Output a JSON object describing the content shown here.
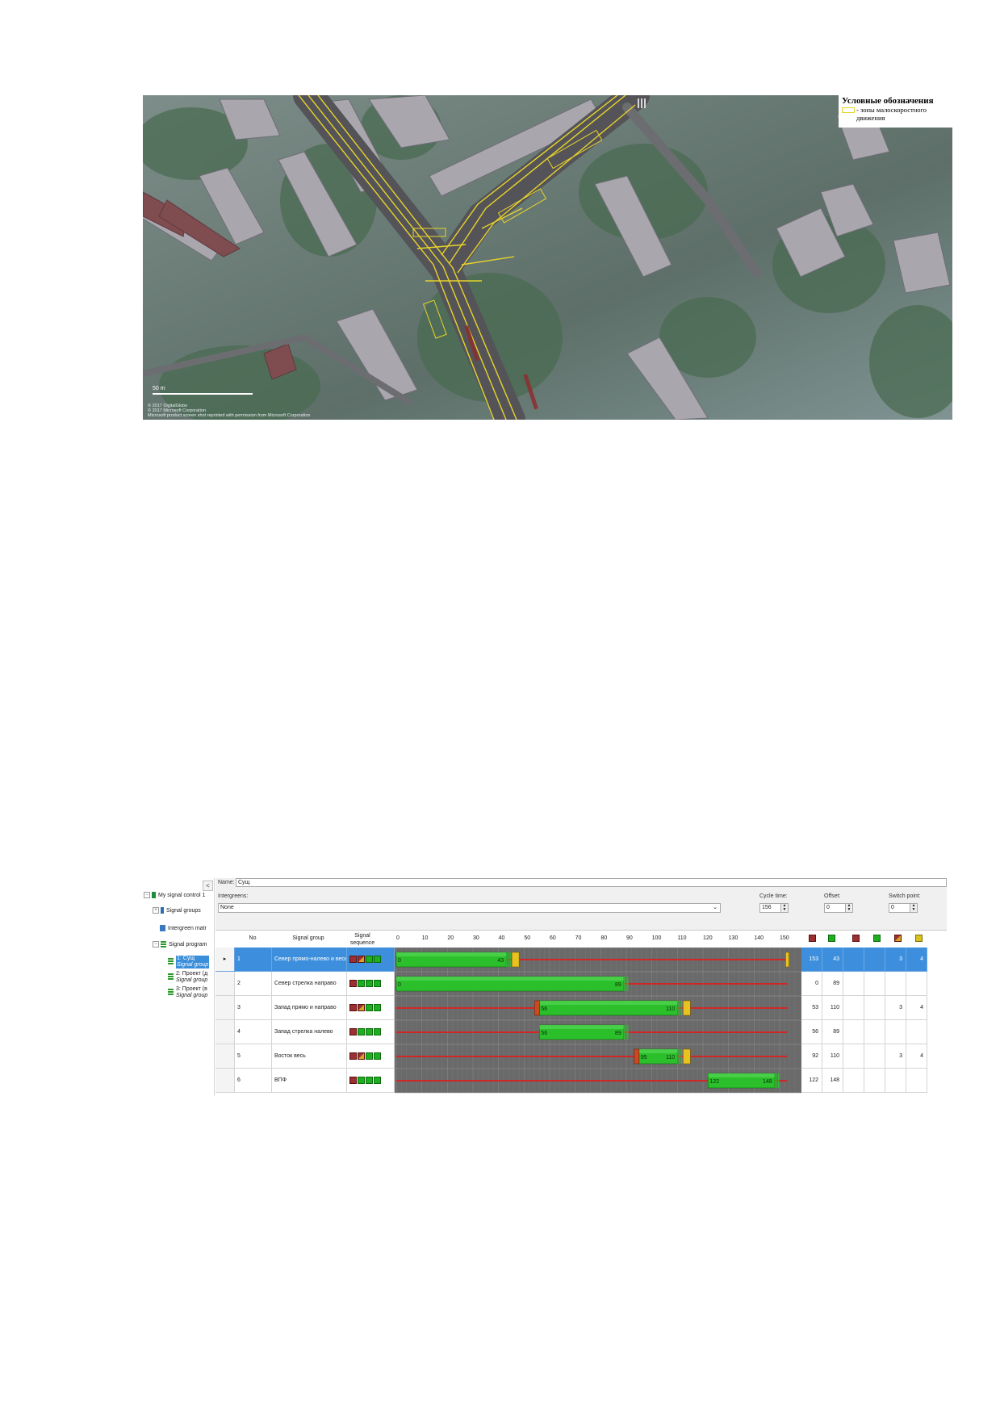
{
  "map": {
    "legend_title": "Условные обозначения",
    "legend_item": "- зоны малоскоростного движения",
    "scale_label": "50 m",
    "copyright": [
      "© 2017 DigitalGlobe",
      "© 2017 Microsoft Corporation",
      "Microsoft product screen shot reprinted with permission from Microsoft Corporation"
    ]
  },
  "tree": {
    "collapse_label": "<",
    "root": "My signal control 1",
    "signal_groups": "Signal groups",
    "intergreen": "Intergreen matr",
    "signal_program": "Signal program",
    "programs": [
      {
        "name": "1: Сущ",
        "sub": "Signal group",
        "selected": true
      },
      {
        "name": "2: Проект (д",
        "sub": "Signal group",
        "selected": false
      },
      {
        "name": "3: Проект (в",
        "sub": "Signal group",
        "selected": false
      }
    ]
  },
  "form": {
    "name_label": "Name:",
    "name_value": "Сущ",
    "intergreens_label": "Intergreens:",
    "intergreens_value": "None",
    "cycle_label": "Cycle time:",
    "cycle_value": "156",
    "offset_label": "Offset:",
    "offset_value": "0",
    "switch_label": "Switch point:",
    "switch_value": "0"
  },
  "table": {
    "headers": {
      "no": "No",
      "group": "Signal group",
      "seq": "Signal sequence"
    },
    "rows": [
      {
        "no": "1",
        "name": "Север прямо-налево и весь...",
        "selected": true,
        "red_end": "153",
        "green_end": "43",
        "c5": "",
        "c6": "",
        "c7": "3",
        "c8": "4"
      },
      {
        "no": "2",
        "name": "Север стрелка направо",
        "selected": false,
        "red_end": "0",
        "green_end": "89",
        "c5": "",
        "c6": "",
        "c7": "",
        "c8": ""
      },
      {
        "no": "3",
        "name": "Запад прямо и направо",
        "selected": false,
        "red_end": "53",
        "green_end": "110",
        "c5": "",
        "c6": "",
        "c7": "3",
        "c8": "4"
      },
      {
        "no": "4",
        "name": "Запад стрелка налево",
        "selected": false,
        "red_end": "56",
        "green_end": "89",
        "c5": "",
        "c6": "",
        "c7": "",
        "c8": ""
      },
      {
        "no": "5",
        "name": "Восток весь",
        "selected": false,
        "red_end": "92",
        "green_end": "110",
        "c5": "",
        "c6": "",
        "c7": "3",
        "c8": "4"
      },
      {
        "no": "6",
        "name": "ВПФ",
        "selected": false,
        "red_end": "122",
        "green_end": "148",
        "c5": "",
        "c6": "",
        "c7": "",
        "c8": ""
      }
    ]
  },
  "chart_data": {
    "type": "gantt",
    "x_ticks": [
      0,
      10,
      20,
      30,
      40,
      50,
      60,
      70,
      80,
      90,
      100,
      110,
      120,
      130,
      140,
      150
    ],
    "xlim": [
      0,
      156
    ],
    "bars": [
      {
        "row": 1,
        "green_start": 0,
        "green_end": 43,
        "labels": [
          "0",
          "43"
        ],
        "amber": true,
        "red_amber": false
      },
      {
        "row": 2,
        "green_start": 0,
        "green_end": 89,
        "labels": [
          "0",
          "89"
        ],
        "amber": false,
        "red_amber": false
      },
      {
        "row": 3,
        "green_start": 56,
        "green_end": 110,
        "labels": [
          "56",
          "110"
        ],
        "amber": true,
        "red_amber": true
      },
      {
        "row": 4,
        "green_start": 56,
        "green_end": 89,
        "labels": [
          "56",
          "89"
        ],
        "amber": false,
        "red_amber": false
      },
      {
        "row": 5,
        "green_start": 95,
        "green_end": 110,
        "labels": [
          "95",
          "110"
        ],
        "amber": true,
        "red_amber": true
      },
      {
        "row": 6,
        "green_start": 122,
        "green_end": 148,
        "labels": [
          "122",
          "148"
        ],
        "amber": false,
        "red_amber": false
      }
    ],
    "colors": {
      "green": "#2bbf2b",
      "red": "#d22626",
      "amber": "#e8c320",
      "background": "#6a6a6a"
    }
  }
}
